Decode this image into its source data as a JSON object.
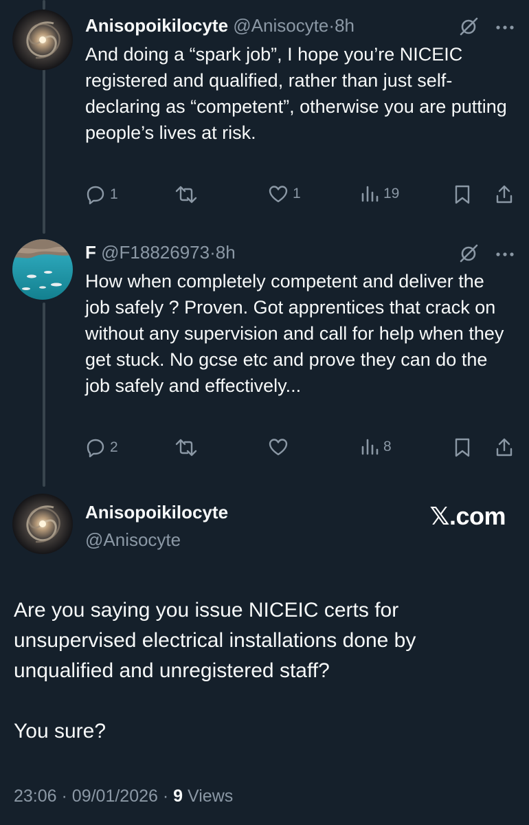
{
  "colors": {
    "background": "#15202b",
    "text": "#f7f9f9",
    "muted": "#8b98a5",
    "thread_line": "#38444d"
  },
  "tweets": [
    {
      "name": "Anisopoikilocyte",
      "handle": "@Anisocyte",
      "separator": "·",
      "time": "8h",
      "text": "And doing a “spark job”, I hope you’re NICEIC registered and qualified, rather than just self-declaring as “competent”, otherwise you are putting people’s lives at risk.",
      "avatar_icon": "galaxy-avatar",
      "actions": {
        "replies": "1",
        "reposts": "",
        "likes": "1",
        "views": "19"
      }
    },
    {
      "name": "F",
      "handle": "@F18826973",
      "separator": "·",
      "time": "8h",
      "text": "How when completely competent and deliver the job safely ? Proven. Got apprentices that crack on without any supervision and call for help when they get stuck. No gcse etc and prove they can do the job safely and effectively...",
      "avatar_icon": "sea-boats-avatar",
      "actions": {
        "replies": "2",
        "reposts": "",
        "likes": "",
        "views": "8"
      }
    }
  ],
  "main_tweet": {
    "name": "Anisopoikilocyte",
    "handle": "@Anisocyte",
    "brand": "𝕏.com",
    "paragraphs": [
      "Are you saying you issue NICEIC certs for unsupervised electrical installations done by unqualified and unregistered staff?",
      "You sure?"
    ],
    "time": "23:06",
    "date": "09/01/2026",
    "views_count": "9",
    "views_label": "Views",
    "separator": "·"
  },
  "icons": [
    "grok-icon",
    "more-icon",
    "reply-icon",
    "repost-icon",
    "like-icon",
    "views-icon",
    "bookmark-icon",
    "share-icon"
  ]
}
